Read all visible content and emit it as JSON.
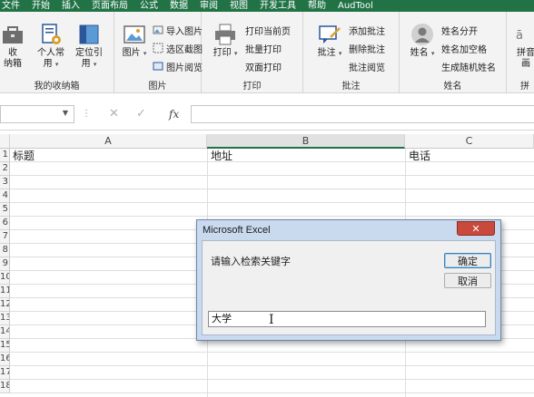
{
  "ribbon_tabs": [
    "文件",
    "开始",
    "插入",
    "页面布局",
    "公式",
    "数据",
    "审阅",
    "视图",
    "开发工具",
    "帮助",
    "AudTool"
  ],
  "groups": {
    "my_box": {
      "label": "我的收纳箱",
      "btn_collect_1": "收",
      "btn_collect_2": "纳箱",
      "btn_personal_1": "个人常",
      "btn_personal_2": "用",
      "btn_locate_1": "定位引",
      "btn_locate_2": "用"
    },
    "picture": {
      "label": "图片",
      "big_button": "图片",
      "items": [
        "导入图片",
        "选区截图",
        "图片阅览"
      ]
    },
    "print": {
      "label": "打印",
      "big_button": "打印",
      "items": [
        "打印当前页",
        "批量打印",
        "双面打印"
      ]
    },
    "comment": {
      "label": "批注",
      "big_button": "批注",
      "items": [
        "添加批注",
        "删除批注",
        "批注阅览"
      ]
    },
    "name": {
      "label": "姓名",
      "big_button": "姓名",
      "items": [
        "姓名分开",
        "姓名加空格",
        "生成随机姓名"
      ]
    },
    "pinyin": {
      "label": "拼",
      "big_button_1": "拼音",
      "big_button_2": "画"
    }
  },
  "formula_bar": {
    "name_box": "",
    "fx": "fx",
    "cancel": "✕",
    "enter": "✓",
    "value": ""
  },
  "columns": [
    "A",
    "B",
    "C"
  ],
  "rows": [
    "1",
    "2",
    "3",
    "4",
    "5",
    "6",
    "7",
    "8",
    "9",
    "10",
    "11",
    "12",
    "13",
    "14",
    "15",
    "16",
    "17",
    "18"
  ],
  "cells": {
    "A1": "标题",
    "B1": "地址",
    "C1": "电话"
  },
  "dialog": {
    "title": "Microsoft Excel",
    "close": "✕",
    "prompt": "请输入检索关键字",
    "ok": "确定",
    "cancel": "取消",
    "input_value": "大学"
  },
  "colors": {
    "accent": "#217346",
    "dialog_frame": "#c9d9ee",
    "close_button": "#c94a3c"
  }
}
